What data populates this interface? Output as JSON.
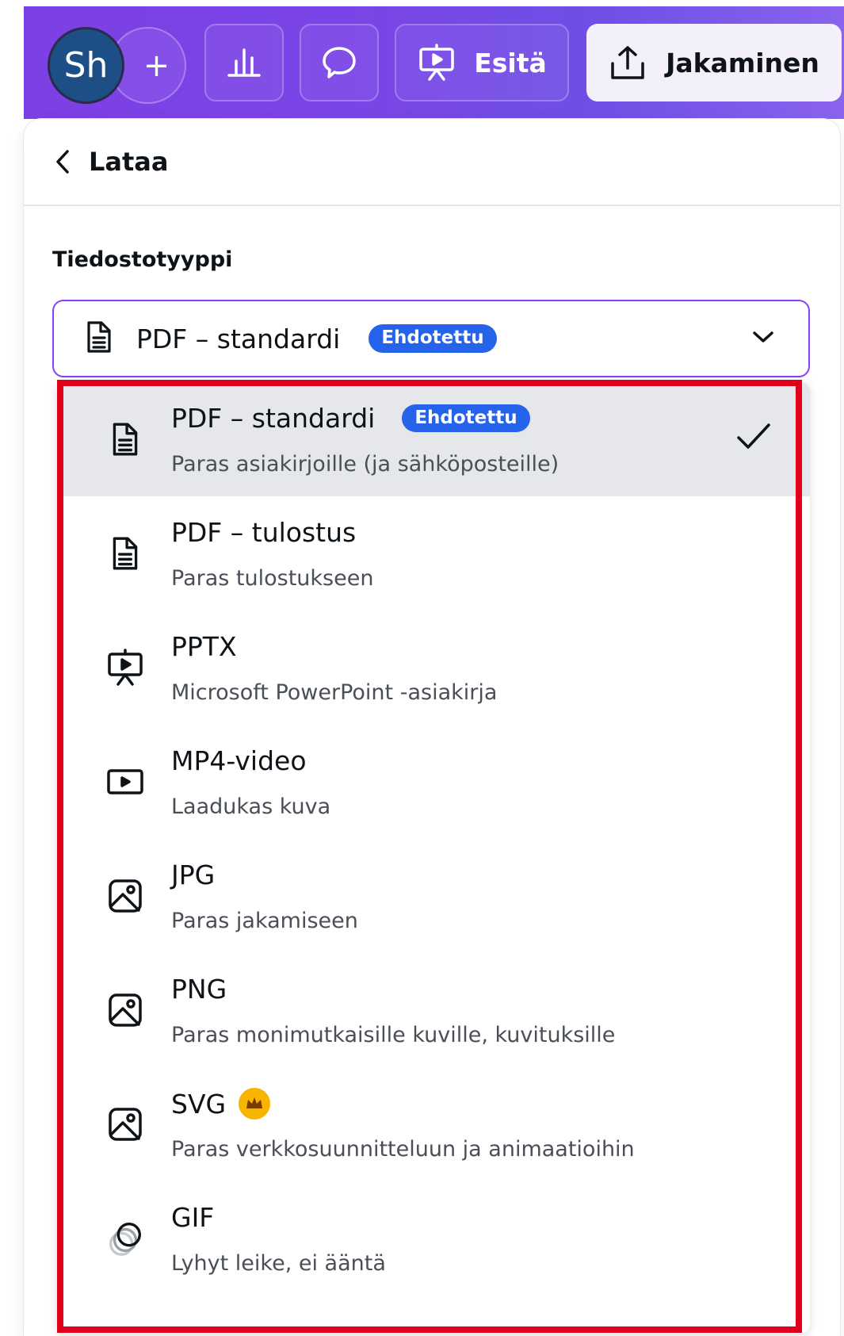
{
  "toolbar": {
    "avatar_initials": "Sh",
    "add_label": "+",
    "present_label": "Esitä",
    "share_label": "Jakaminen",
    "background_color": "#7c3fe4"
  },
  "panel": {
    "back_icon": "chevron-left-icon",
    "title": "Lataa",
    "file_type_label": "Tiedostotyyppi",
    "select": {
      "value": "PDF – standardi",
      "badge": "Ehdotettu",
      "border_color": "#8b3dff"
    }
  },
  "menu": {
    "items": [
      {
        "title": "PDF – standardi",
        "badge": "Ehdotettu",
        "desc": "Paras asiakirjoille (ja sähköposteille)",
        "icon": "document-icon",
        "selected": true
      },
      {
        "title": "PDF – tulostus",
        "desc": "Paras tulostukseen",
        "icon": "document-icon"
      },
      {
        "title": "PPTX",
        "desc": "Microsoft PowerPoint -asiakirja",
        "icon": "presentation-icon"
      },
      {
        "title": "MP4-video",
        "desc": "Laadukas kuva",
        "icon": "video-icon"
      },
      {
        "title": "JPG",
        "desc": "Paras jakamiseen",
        "icon": "image-icon"
      },
      {
        "title": "PNG",
        "desc": "Paras monimutkaisille kuville, kuvituksille",
        "icon": "image-icon"
      },
      {
        "title": "SVG",
        "desc": "Paras verkkosuunnitteluun ja animaatioihin",
        "icon": "image-icon",
        "premium": true
      },
      {
        "title": "GIF",
        "desc": "Lyhyt leike, ei ääntä",
        "icon": "gif-icon"
      }
    ]
  },
  "colors": {
    "badge": "#2563eb",
    "selected_row": "#e6e7ea",
    "highlight": "#e0001b",
    "crown": "#f7b500"
  }
}
